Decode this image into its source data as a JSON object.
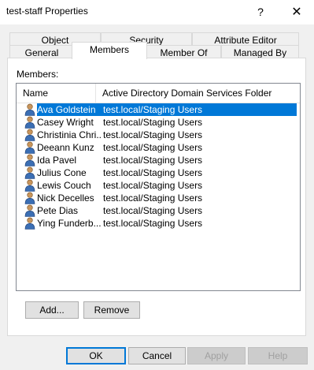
{
  "window": {
    "title": "test-staff Properties",
    "help_glyph": "?",
    "close_glyph": "✕"
  },
  "tabs_row1": [
    {
      "label": "Object"
    },
    {
      "label": "Security"
    },
    {
      "label": "Attribute Editor"
    }
  ],
  "tabs_row2": [
    {
      "label": "General"
    },
    {
      "label": "Members",
      "active": true
    },
    {
      "label": "Member Of"
    },
    {
      "label": "Managed By"
    }
  ],
  "members": {
    "label": "Members:",
    "columns": {
      "name": "Name",
      "folder": "Active Directory Domain Services Folder"
    },
    "rows": [
      {
        "name": "Ava Goldstein",
        "folder": "test.local/Staging Users",
        "selected": true
      },
      {
        "name": "Casey Wright",
        "folder": "test.local/Staging Users"
      },
      {
        "name": "Christinia Chri...",
        "folder": "test.local/Staging Users"
      },
      {
        "name": "Deeann Kunz",
        "folder": "test.local/Staging Users"
      },
      {
        "name": "Ida Pavel",
        "folder": "test.local/Staging Users"
      },
      {
        "name": "Julius Cone",
        "folder": "test.local/Staging Users"
      },
      {
        "name": "Lewis Couch",
        "folder": "test.local/Staging Users"
      },
      {
        "name": "Nick Decelles",
        "folder": "test.local/Staging Users"
      },
      {
        "name": "Pete Dias",
        "folder": "test.local/Staging Users"
      },
      {
        "name": "Ying Funderb...",
        "folder": "test.local/Staging Users"
      }
    ],
    "row_icon": "user-icon"
  },
  "panel_buttons": {
    "add": "Add...",
    "remove": "Remove"
  },
  "dialog_buttons": {
    "ok": "OK",
    "cancel": "Cancel",
    "apply": "Apply",
    "help": "Help"
  },
  "colors": {
    "selection": "#0078d7",
    "dialog_bg": "#f0f0f0"
  }
}
